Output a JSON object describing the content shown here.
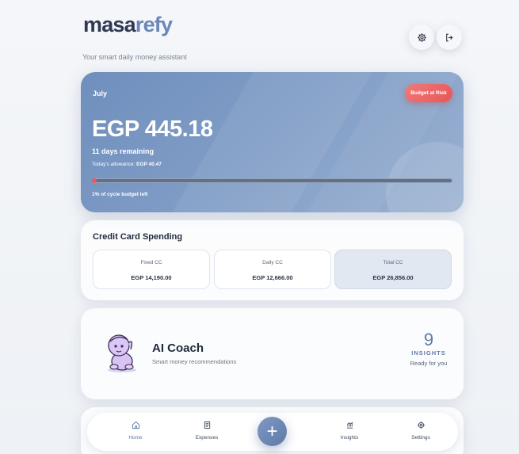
{
  "app": {
    "logo_primary": "masa",
    "logo_accent": "refy",
    "tagline": "Your smart daily money assistant"
  },
  "header": {
    "settings_icon": "gear-icon",
    "logout_icon": "logout-icon"
  },
  "budget": {
    "month": "July",
    "status_badge": "Budget at Risk",
    "amount": "EGP 445.18",
    "days_remaining": "11 days remaining",
    "allowance_label": "Today's allowance:",
    "allowance_value": "EGP 40.47",
    "progress_fraction": 0.01,
    "progress_text": "1% of cycle budget left",
    "colors": {
      "badge": "#e85656",
      "progress": "#e95b5b"
    }
  },
  "credit_card": {
    "title": "Credit Card Spending",
    "items": [
      {
        "label": "Fixed CC",
        "value": "EGP 14,190.00"
      },
      {
        "label": "Daily CC",
        "value": "EGP 12,666.00"
      },
      {
        "label": "Total CC",
        "value": "EGP 26,856.00"
      }
    ]
  },
  "coach": {
    "title": "AI Coach",
    "subtitle": "Smart money recommendations",
    "count": "9",
    "count_label": "INSIGHTS",
    "ready_text": "Ready for you"
  },
  "nav": {
    "items": [
      {
        "label": "Home",
        "icon": "home-icon"
      },
      {
        "label": "Expenses",
        "icon": "receipt-icon"
      },
      {
        "label": "Insights",
        "icon": "chart-icon"
      },
      {
        "label": "Settings",
        "icon": "gear-icon"
      }
    ],
    "fab_label": "+"
  }
}
